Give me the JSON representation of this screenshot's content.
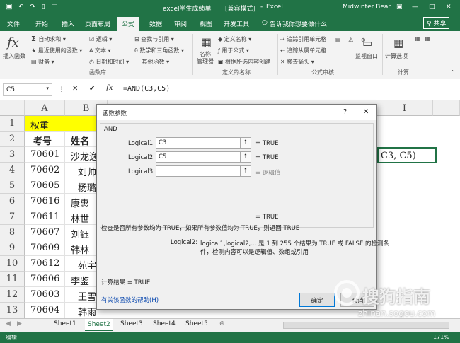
{
  "titlebar": {
    "quick_access": "↶ ↷ ▯ ☰",
    "document": "excel学生成绩单",
    "mode": "[兼容模式]",
    "app": "Excel",
    "user": "Midwinter Bear",
    "ribbon_display": "▣",
    "minimize": "—",
    "restore": "□",
    "close": "✕"
  },
  "ribbon_tabs": [
    "文件",
    "开始",
    "插入",
    "页面布局",
    "公式",
    "数据",
    "审阅",
    "视图",
    "开发工具"
  ],
  "active_tab": "公式",
  "tell_me": "告诉我你想要做什么",
  "share": "共享",
  "ribbon": {
    "insert_function": "插入函数",
    "autosum": "自动求和",
    "recent": "最近使用的函数",
    "financial": "财务",
    "logical": "逻辑",
    "text": "文本",
    "datetime": "日期和时间",
    "lookup": "查找与引用",
    "math": "数学和三角函数",
    "more": "其他函数",
    "group_library": "函数库",
    "name_manager": "名称\n管理器",
    "define_name": "定义名称",
    "use_in_formula": "用于公式",
    "create_from_sel": "根据所选内容创建",
    "group_names": "定义的名称",
    "trace_precedents": "追踪引用单元格",
    "trace_dependents": "追踪从属单元格",
    "remove_arrows": "移去箭头",
    "group_audit": "公式审核",
    "watch_window": "监视窗口",
    "calc_options": "计算选项",
    "group_calc": "计算"
  },
  "formula_bar": {
    "name_box": "C5",
    "cancel": "✕",
    "enter": "✔",
    "fx": "fx",
    "formula": "=AND(C3,C5)"
  },
  "sheet": {
    "columns": [
      "A",
      "B",
      "I"
    ],
    "rows": [
      "1",
      "2",
      "3",
      "4",
      "5",
      "6",
      "7",
      "8",
      "9",
      "10",
      "11",
      "12",
      "13"
    ],
    "a_col": [
      "权重",
      "考号",
      "70601",
      "70602",
      "70605",
      "70616",
      "70611",
      "70607",
      "70609",
      "70612",
      "70606",
      "70603",
      "70604"
    ],
    "b_col": [
      "",
      "姓名",
      "沙龙逸",
      "刘帅",
      "杨璐",
      "康惠",
      "林世",
      "刘钰",
      "韩林",
      "苑宇",
      "李鉴",
      "王雪",
      "韩雨"
    ],
    "edit_preview": "C3, C5)"
  },
  "dialog": {
    "title": "函数参数",
    "help": "?",
    "close": "✕",
    "function_name": "AND",
    "args": [
      {
        "label": "Logical1",
        "value": "C3",
        "result": "= TRUE"
      },
      {
        "label": "Logical2",
        "value": "C5",
        "result": "= TRUE"
      },
      {
        "label": "Logical3",
        "value": "",
        "result": "= 逻辑值"
      }
    ],
    "ref_icon": "⭡",
    "overall": "= TRUE",
    "description": "检查是否所有参数均为 TRUE，如果所有参数值均为 TRUE，则返回 TRUE",
    "arg_help_label": "Logical2:",
    "arg_help_1": "logical1,logical2,... 是 1 到 255 个结果为 TRUE 或 FALSE 的检测条",
    "arg_help_2": "件，检测内容可以是逻辑值、数组或引用",
    "calc_result": "计算结果 =  TRUE",
    "help_link": "有关该函数的帮助(H)",
    "ok": "确定",
    "cancel": "取消"
  },
  "sheets": [
    "Sheet1",
    "Sheet2",
    "Sheet3",
    "Sheet4",
    "Sheet5"
  ],
  "active_sheet": "Sheet2",
  "status": {
    "mode": "编辑",
    "zoom": "171%"
  },
  "watermark": {
    "brand": "搜狗指南",
    "url": "zhinan.sogou.com"
  },
  "colors": {
    "excel_green": "#217346",
    "header_yellow": "#ffff00"
  }
}
